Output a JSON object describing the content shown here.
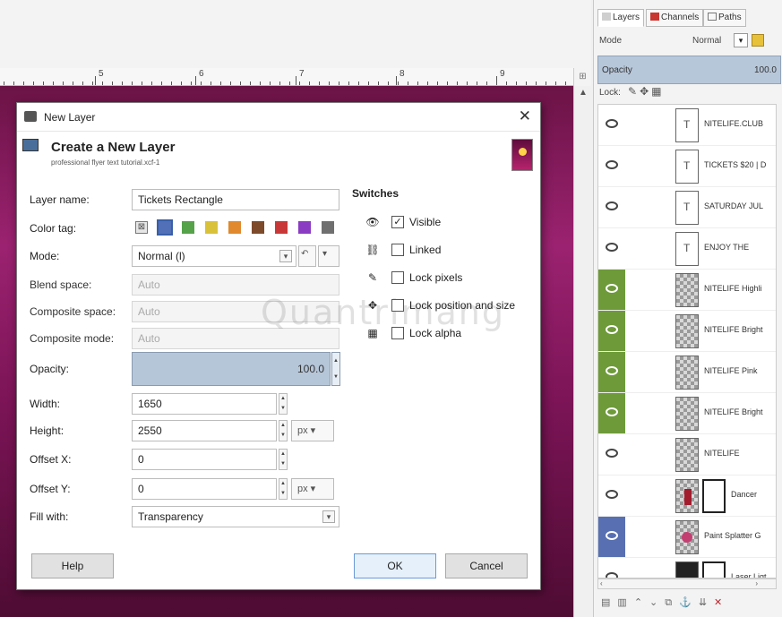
{
  "ruler": {
    "numbers": [
      "5",
      "6",
      "7",
      "8",
      "9"
    ]
  },
  "dialog": {
    "window_title": "New Layer",
    "close_glyph": "✕",
    "header_title": "Create a New Layer",
    "header_subtitle": "professional flyer text tutorial.xcf-1",
    "labels": {
      "layer_name": "Layer name:",
      "color_tag": "Color tag:",
      "mode": "Mode:",
      "blend_space": "Blend space:",
      "composite_space": "Composite space:",
      "composite_mode": "Composite mode:",
      "opacity": "Opacity:",
      "width": "Width:",
      "height": "Height:",
      "offset_x": "Offset X:",
      "offset_y": "Offset Y:",
      "fill_with": "Fill with:"
    },
    "values": {
      "layer_name": "Tickets Rectangle",
      "mode": "Normal (l)",
      "blend_space": "Auto",
      "composite_space": "Auto",
      "composite_mode": "Auto",
      "opacity": "100.0",
      "width": "1650",
      "height": "2550",
      "offset_x": "0",
      "offset_y": "0",
      "unit_height": "px",
      "unit_offset": "px",
      "fill_with": "Transparency"
    },
    "color_tags": [
      "#a9a9a9",
      "#5170b8",
      "#55a24a",
      "#d9c23a",
      "#e0892e",
      "#7d4a2c",
      "#c93838",
      "#8a3cc3",
      "#6f6f6f"
    ],
    "switches": {
      "title": "Switches",
      "items": [
        {
          "label": "Visible",
          "checked": "✓",
          "icon": "eye-icon"
        },
        {
          "label": "Linked",
          "checked": "",
          "icon": "chain-icon"
        },
        {
          "label": "Lock pixels",
          "checked": "",
          "icon": "brush-icon"
        },
        {
          "label": "Lock position and size",
          "checked": "",
          "icon": "move-icon"
        },
        {
          "label": "Lock alpha",
          "checked": "",
          "icon": "checker-icon"
        }
      ]
    },
    "watermark": "Quantrimang",
    "buttons": {
      "help": "Help",
      "ok": "OK",
      "cancel": "Cancel"
    }
  },
  "layers_panel": {
    "tabs": [
      "Layers",
      "Channels",
      "Paths"
    ],
    "mode_label": "Mode",
    "mode_value": "Normal",
    "opacity_label": "Opacity",
    "opacity_value": "100.0",
    "lock_label": "Lock:",
    "layers": [
      {
        "name": "NITELIFE.CLUB",
        "thumb": "text",
        "vis": "none"
      },
      {
        "name": "TICKETS $20 | D",
        "thumb": "text",
        "vis": "none"
      },
      {
        "name": "SATURDAY JUL",
        "thumb": "text",
        "vis": "none"
      },
      {
        "name": "ENJOY THE",
        "thumb": "text",
        "vis": "none"
      },
      {
        "name": "NITELIFE Highli",
        "thumb": "checker",
        "vis": "green"
      },
      {
        "name": "NITELIFE Bright",
        "thumb": "checker",
        "vis": "green"
      },
      {
        "name": "NITELIFE Pink",
        "thumb": "checker",
        "vis": "green"
      },
      {
        "name": "NITELIFE Bright",
        "thumb": "checker",
        "vis": "green"
      },
      {
        "name": "NITELIFE",
        "thumb": "checker",
        "vis": "none"
      },
      {
        "name": "Dancer",
        "thumb": "dancer",
        "vis": "none",
        "mask": true
      },
      {
        "name": "Paint Splatter G",
        "thumb": "splat",
        "vis": "blue"
      },
      {
        "name": "Laser Ligt",
        "thumb": "dark",
        "vis": "none",
        "mask": true
      }
    ]
  }
}
